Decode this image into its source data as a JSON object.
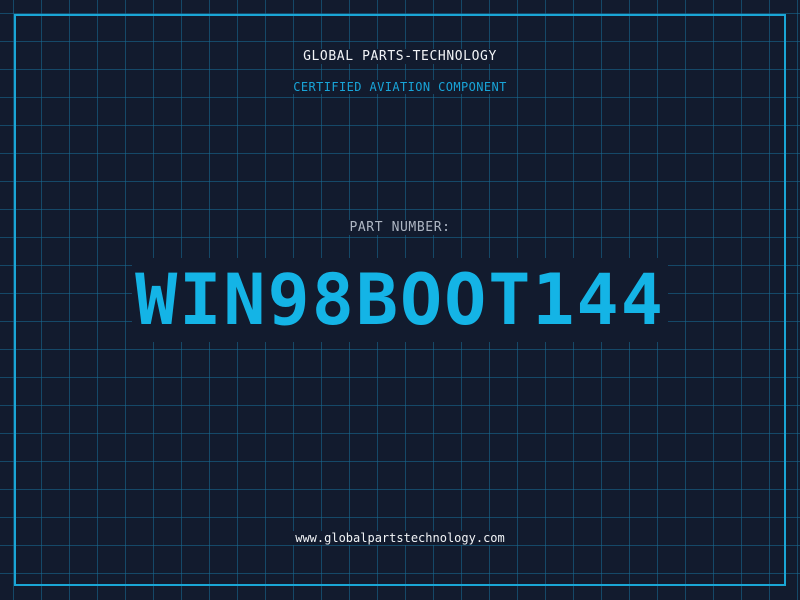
{
  "header": {
    "company_name": "GLOBAL PARTS-TECHNOLOGY",
    "subtitle": "CERTIFIED AVIATION COMPONENT"
  },
  "part": {
    "label": "PART NUMBER:",
    "number": "WIN98BOOT144"
  },
  "footer": {
    "website": "www.globalpartstechnology.com"
  },
  "colors": {
    "background": "#121b2e",
    "grid": "#186e96",
    "accent": "#14b4e6",
    "frame": "#1aa6d6",
    "text_primary": "#f2f4f7",
    "text_muted": "#aeb6c3"
  }
}
